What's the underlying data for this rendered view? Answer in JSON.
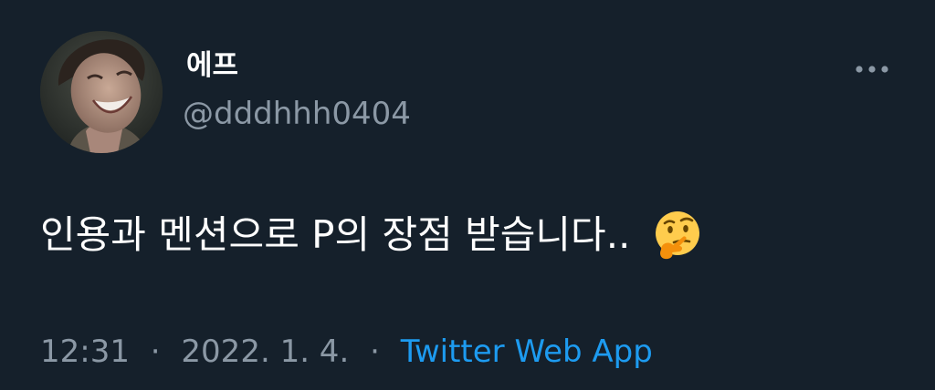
{
  "user": {
    "display_name": "에프",
    "handle": "@dddhhh0404"
  },
  "tweet": {
    "text": "인용과 멘션으로 P의 장점 받습니다..",
    "emoji": "thinking-face"
  },
  "meta": {
    "time": "12:31",
    "separator": "·",
    "date": "2022. 1. 4.",
    "source": "Twitter Web App"
  },
  "colors": {
    "background": "#15202b",
    "secondary_text": "#8b98a5",
    "link": "#1d9bf0"
  },
  "icons": {
    "more": "more-horizontal-icon",
    "avatar": "profile-photo"
  }
}
